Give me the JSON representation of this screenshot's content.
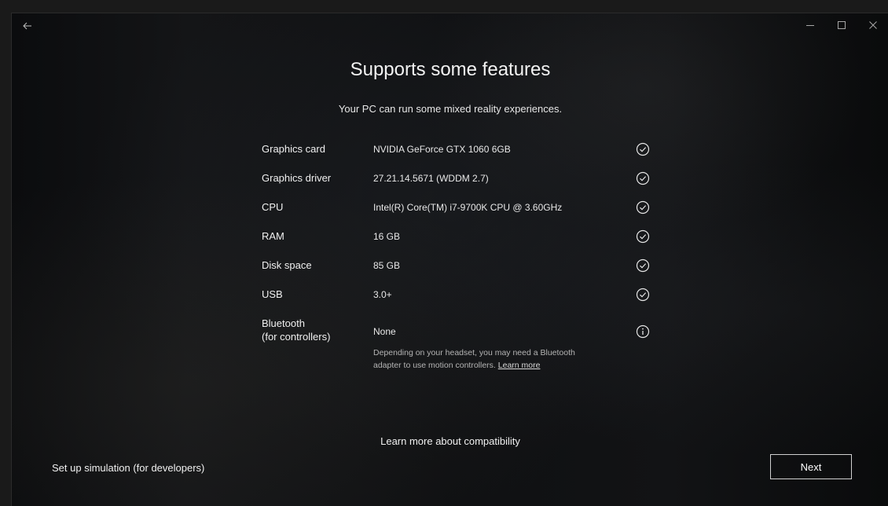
{
  "window": {
    "back_icon": "back-arrow-icon",
    "caption": {
      "minimize_icon": "minimize-icon",
      "maximize_icon": "maximize-icon",
      "close_icon": "close-icon"
    }
  },
  "header": {
    "title": "Supports some features",
    "subtitle": "Your PC can run some mixed reality experiences."
  },
  "requirements": [
    {
      "label": "Graphics card",
      "value": "NVIDIA GeForce GTX 1060 6GB",
      "status": "check-circle-icon"
    },
    {
      "label": "Graphics driver",
      "value": "27.21.14.5671 (WDDM 2.7)",
      "status": "check-circle-icon"
    },
    {
      "label": "CPU",
      "value": "Intel(R) Core(TM) i7-9700K CPU @ 3.60GHz",
      "status": "check-circle-icon"
    },
    {
      "label": "RAM",
      "value": "16 GB",
      "status": "check-circle-icon"
    },
    {
      "label": "Disk space",
      "value": "85 GB",
      "status": "check-circle-icon"
    },
    {
      "label": "USB",
      "value": "3.0+",
      "status": "check-circle-icon"
    },
    {
      "label_line1": "Bluetooth",
      "label_line2": "(for controllers)",
      "value": "None",
      "status": "info-circle-icon"
    }
  ],
  "bluetooth_note": {
    "text_line1": "Depending on your headset, you may need a Bluetooth",
    "text_line2": "adapter to use motion controllers.",
    "link": "Learn more"
  },
  "footer": {
    "learn_more_compat": "Learn more about compatibility",
    "simulation_link": "Set up simulation (for developers)",
    "next_label": "Next"
  },
  "colors": {
    "background": "#0f1012",
    "text": "#ffffff",
    "muted_text": "#b4b4b4"
  }
}
